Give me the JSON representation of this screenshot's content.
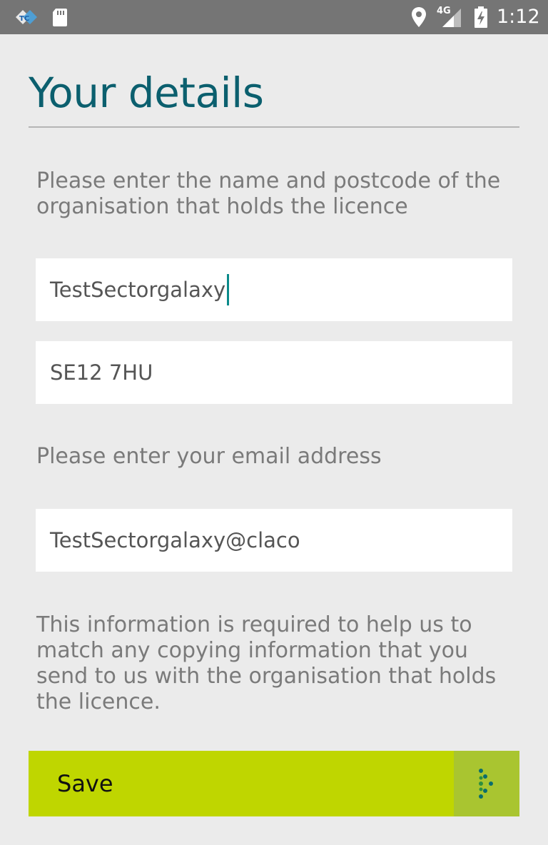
{
  "status_bar": {
    "network": "4G",
    "time": "1:12"
  },
  "page": {
    "title": "Your details",
    "instruction_org": "Please enter the name and postcode of the organisation that holds the licence",
    "instruction_email": "Please enter your email address",
    "info_text": "This information is required to help us to match any copying information that you send to us with the organisation that holds the licence."
  },
  "form": {
    "organisation_value": "TestSectorgalaxy",
    "postcode_value": "SE12 7HU",
    "email_value": "TestSectorgalaxy@claco"
  },
  "actions": {
    "save_label": "Save"
  },
  "colors": {
    "title": "#0b5f6e",
    "save_button": "#bfd600",
    "status_bar": "#757575",
    "background": "#ebebeb"
  }
}
